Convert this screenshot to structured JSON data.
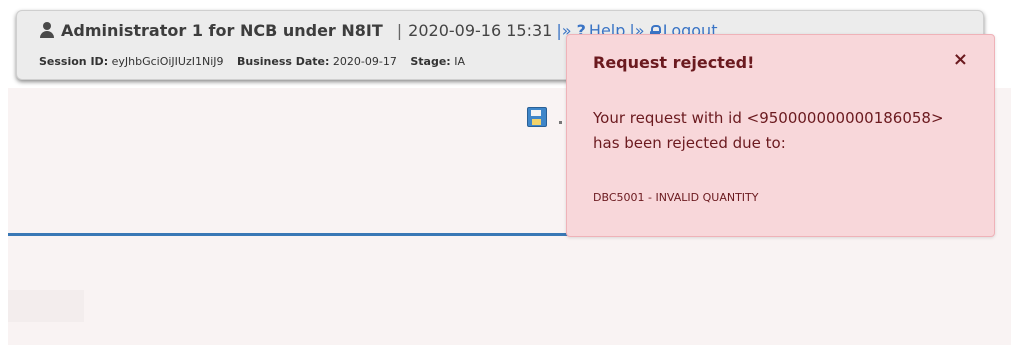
{
  "header": {
    "user_label": "Administrator 1 for NCB under N8IT",
    "separator": "|",
    "timestamp": "2020-09-16 15:31",
    "link_separator_1": "|»",
    "help_label": "Help",
    "link_separator_2": "|»",
    "logout_label": "Logout",
    "session_id_label": "Session ID:",
    "session_id_value": "eyJhbGciOiJIUzI1NiJ9",
    "business_date_label": "Business Date:",
    "business_date_value": "2020-09-17",
    "stage_label": "Stage:",
    "stage_value": "IA"
  },
  "toast": {
    "title": "Request rejected!",
    "close_glyph": "×",
    "message": "Your request with id <950000000000186058> has been rejected due to:",
    "detail": "DBC5001 - INVALID QUANTITY"
  },
  "colors": {
    "toast_background": "#f8d7da",
    "toast_text": "#6b1a1f",
    "link": "#3a74c5",
    "rule": "#3a78b5"
  }
}
